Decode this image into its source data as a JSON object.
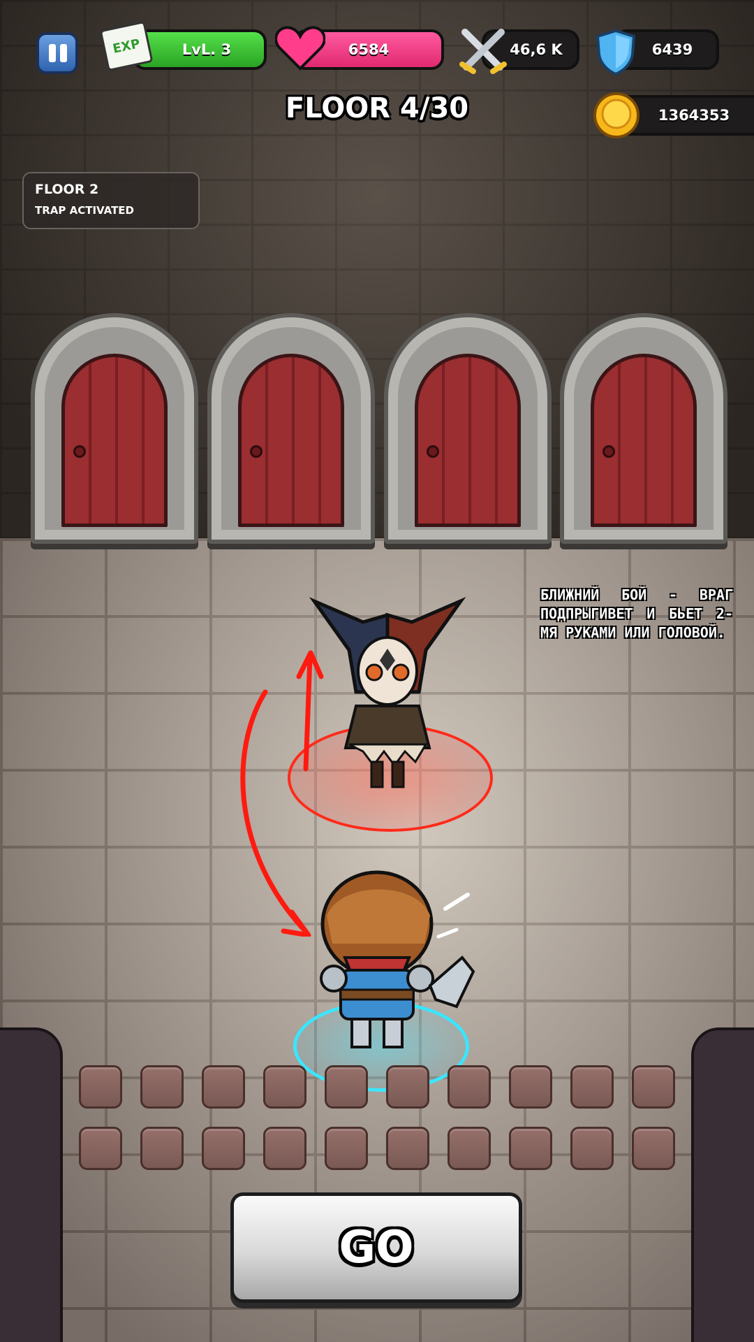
{
  "hud": {
    "level_label": "LvL. 3",
    "exp_badge": "EXP",
    "health": "6584",
    "attack": "46,6 K",
    "defense": "6439",
    "gold": "1364353"
  },
  "floor_title": "FLOOR 4/30",
  "event_log": {
    "title": "FLOOR 2",
    "message": "TRAP ACTIVATED"
  },
  "tutorial_note": "Ближний бой - враг подпрыгивет и бьет 2-мя руками или головой.",
  "go_button": "GO",
  "icons": {
    "pause": "pause-icon",
    "exp": "exp-scroll-icon",
    "health": "heart-icon",
    "attack": "crossed-swords-icon",
    "defense": "shield-icon",
    "gold": "gold-coin-icon"
  },
  "colors": {
    "level_bar": "#33c32b",
    "health_bar": "#f0347f",
    "enemy_ring": "#ff2a1a",
    "hero_ring": "#3ae6ff"
  }
}
